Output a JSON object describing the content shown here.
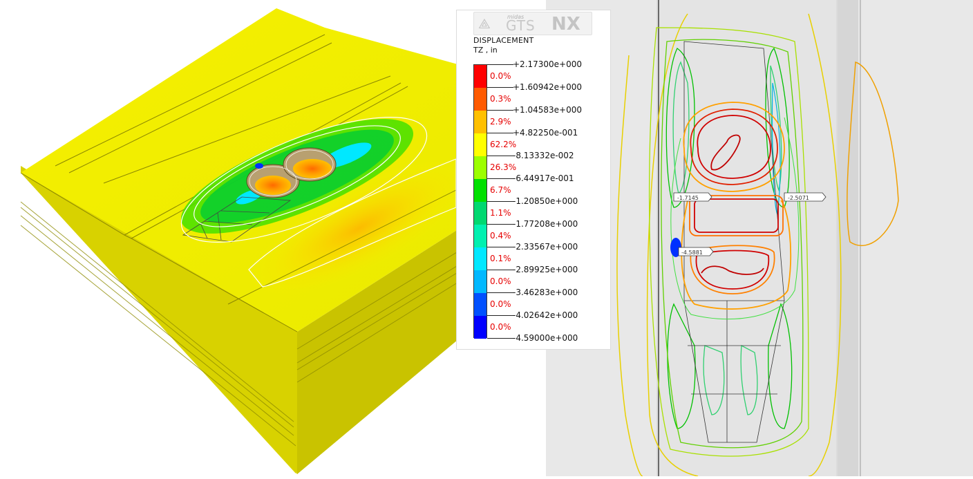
{
  "logo": {
    "mark": "⟁",
    "small": "midas",
    "gts": "GTS",
    "nx": "NX"
  },
  "legend": {
    "title": "DISPLACEMENT",
    "subtitle": "TZ , in",
    "values": [
      "+2.17300e+000",
      "+1.60942e+000",
      "+1.04583e+000",
      "+4.82250e-001",
      "-8.13332e-002",
      "-6.44917e-001",
      "-1.20850e+000",
      "-1.77208e+000",
      "-2.33567e+000",
      "-2.89925e+000",
      "-3.46283e+000",
      "-4.02642e+000",
      "-4.59000e+000"
    ],
    "percentages": [
      "0.0%",
      "0.3%",
      "2.9%",
      "62.2%",
      "26.3%",
      "6.7%",
      "1.1%",
      "0.4%",
      "0.1%",
      "0.0%",
      "0.0%",
      "0.0%"
    ],
    "colors": [
      "#ff0000",
      "#ff5a00",
      "#ffc000",
      "#ffff00",
      "#9cff00",
      "#00e000",
      "#00d870",
      "#00f0b0",
      "#00e8ff",
      "#00b8ff",
      "#0050ff",
      "#0000ff"
    ],
    "pct_color": "#e60000"
  },
  "labels": {
    "left": "-1.7145",
    "right": "-2.5071",
    "lower": "-4.5881"
  }
}
